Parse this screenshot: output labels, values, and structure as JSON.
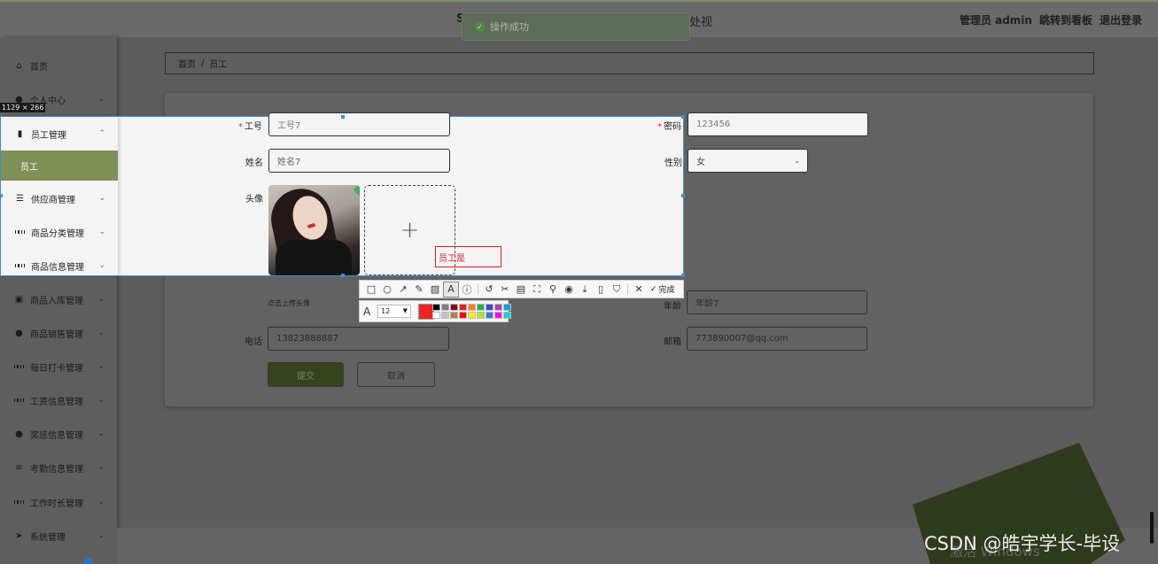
{
  "header": {
    "title_prefix": "S",
    "title_suffix": "处视",
    "admin_label": "管理员 admin",
    "goto_dashboard": "跳转到看板",
    "logout": "退出登录"
  },
  "toast": {
    "message": "操作成功"
  },
  "sidebar": {
    "items": [
      {
        "label": "首页",
        "icon": "home-icon"
      },
      {
        "label": "个人中心",
        "icon": "user-icon"
      },
      {
        "label": "员工管理",
        "icon": "bar-chart-icon"
      },
      {
        "label": "员工",
        "icon": ""
      },
      {
        "label": "供应商管理",
        "icon": "list-icon"
      },
      {
        "label": "商品分类管理",
        "icon": "grid-icon"
      },
      {
        "label": "商品信息管理",
        "icon": "grid-icon"
      },
      {
        "label": "商品入库管理",
        "icon": "image-icon"
      },
      {
        "label": "商品销售管理",
        "icon": "user-icon"
      },
      {
        "label": "每日打卡管理",
        "icon": "grid-icon"
      },
      {
        "label": "工资信息管理",
        "icon": "grid-icon"
      },
      {
        "label": "奖惩信息管理",
        "icon": "user-icon"
      },
      {
        "label": "考勤信息管理",
        "icon": "sliders-icon"
      },
      {
        "label": "工作时长管理",
        "icon": "grid-icon"
      },
      {
        "label": "系统管理",
        "icon": "send-icon"
      }
    ]
  },
  "breadcrumb": {
    "home": "首页",
    "sep": "/",
    "current": "员工"
  },
  "form": {
    "employee_no_label": "工号",
    "employee_no_value": "工号7",
    "password_label": "密码",
    "password_value": "123456",
    "name_label": "姓名",
    "name_value": "姓名7",
    "gender_label": "性别",
    "gender_value": "女",
    "avatar_label": "头像",
    "upload_hint": "点击上传头像",
    "age_label": "年龄",
    "age_value": "年龄7",
    "phone_label": "电话",
    "phone_value": "13823888887",
    "email_label": "邮箱",
    "email_value": "773890007@qq.com",
    "submit": "提交",
    "cancel": "取消"
  },
  "capture": {
    "size_label": "1129 × 266",
    "text_annotation": "员工是",
    "font_size": "12",
    "done_label": "完成",
    "current_color": "#ef2323",
    "palette": [
      "#000000",
      "#7f7f7f",
      "#880015",
      "#ed1c24",
      "#ff7f27",
      "#22b14c",
      "#3f48cc",
      "#a349a4",
      "#00a2e8",
      "#ffffff",
      "#c3c3c3",
      "#b97a57",
      "#ff0000",
      "#fff200",
      "#b5e61d",
      "#2f7dd7",
      "#ff00ff",
      "#00d5d5"
    ]
  },
  "watermark": {
    "csdn": "CSDN @皓宇学长-毕设",
    "windows": "激活 Windows"
  },
  "colors": {
    "accent_green": "#7f8f55",
    "deco_green": "#2f3a1c"
  }
}
